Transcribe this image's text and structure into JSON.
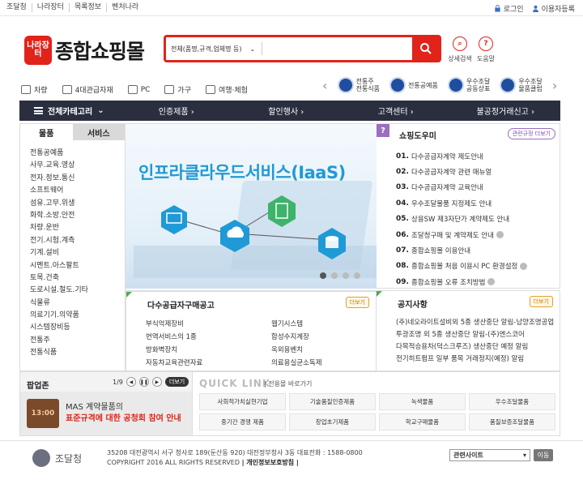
{
  "topbar": {
    "links": [
      "조달청",
      "나라장터",
      "목록정보",
      "벤처나라"
    ],
    "login": "로그인",
    "register": "이용자등록"
  },
  "header": {
    "logo_badge": "나라장터",
    "logo_text": "종합쇼핑몰",
    "search_category": "전체(품명,규격,업체명 등)",
    "search_value": "",
    "detail_search": "상세검색",
    "help": "도움말"
  },
  "quick_categories": [
    "차량",
    "4대관급자재",
    "PC",
    "가구",
    "여행·체험"
  ],
  "certs": [
    {
      "line1": "전통주",
      "line2": "전통식품"
    },
    {
      "line1": "전통공예품",
      "line2": ""
    },
    {
      "line1": "우수조달",
      "line2": "공동상표"
    },
    {
      "line1": "우수조달",
      "line2": "물품클럽"
    }
  ],
  "nav": {
    "all": "전체카테고리",
    "items": [
      "인증제품 ›",
      "할인행사 ›",
      "고객센터 ›",
      "불공정거래신고 ›"
    ]
  },
  "left_panel": {
    "tab_goods": "물품",
    "tab_service": "서비스",
    "items": [
      "전통공예품",
      "사무.교육.영상",
      "전자.정보.통신",
      "소프트웨어",
      "섬유.고무.위생",
      "화학.소방.안전",
      "차량.운반",
      "전기.시험.계측",
      "기계.설비",
      "시멘트.아스팔트",
      "토목.건축",
      "도로시설.철도.기타",
      "식물류",
      "의료기기.의약품",
      "시스템장비등",
      "전통주",
      "전통식품"
    ]
  },
  "banner": {
    "title": "인프라클라우드서비스(IaaS)"
  },
  "shopping_help": {
    "title": "쇼핑도우미",
    "more": "관련규정 더보기",
    "items": [
      {
        "num": "01.",
        "text": "다수공급자계약 제도안내"
      },
      {
        "num": "02.",
        "text": "다수공급자계약 관련 매뉴얼"
      },
      {
        "num": "03.",
        "text": "다수공급자계약 교육안내"
      },
      {
        "num": "04.",
        "text": "우수조달물품 지정제도 안내"
      },
      {
        "num": "05.",
        "text": "상용SW 제3자단가 계약제도 안내"
      },
      {
        "num": "06.",
        "text": "조달청구매 및 계약제도 안내"
      },
      {
        "num": "07.",
        "text": "종합쇼핑몰 이용안내"
      },
      {
        "num": "08.",
        "text": "종합쇼핑몰 처음 이용시 PC 환경설정"
      },
      {
        "num": "09.",
        "text": "종합쇼핑몰 오류 조치방법"
      }
    ]
  },
  "multi_supplier": {
    "title": "다수공급자구매공고",
    "more": "더보기",
    "items": [
      "부식억제장비",
      "웹기시스템",
      "번역서비스의 1종",
      "합성수지계장",
      "방화벽장치",
      "옥외용벤치",
      "자동차교육관련자료",
      "의료용실균소독제"
    ]
  },
  "notice": {
    "title": "공지사항",
    "more": "더보기",
    "items": [
      "(주)네오라이트설비외 5종 생산중단 알림-남양조명공업",
      "투광조명 외 5종 생산중단 알림-(주)엔스코어",
      "다목적승용차(덕스크루즈) 생산중단 예정 알림",
      "전기히트펌프 일부 품목 거래정지(예정) 알림"
    ]
  },
  "popup_zone": {
    "title": "팝업존",
    "page": "1/9",
    "more": "더보기",
    "clock": "13:00",
    "line1": "MAS 계약물품의",
    "line2": "표준규격에 대한 공청회 참여 안내"
  },
  "quick_link": {
    "title": "QUICK LINK",
    "subtitle": "| 전용몰 바로가기",
    "items": [
      "사회적가치실현기업",
      "기술품질인증제품",
      "녹색물품",
      "우수조달물품",
      "중기간 경쟁 제품",
      "창업초기제품",
      "학교구매물품",
      "품질보증조달물품"
    ]
  },
  "footer": {
    "org": "조달청",
    "address": "35208 대전광역시 서구 청사로 189(둔산동 920) 대전정부청사 3동 대표전화 : 1588-0800",
    "copyright": "COPYRIGHT 2016 ALL RIGHTS RESERVED",
    "privacy": "| 개인정보보호방침 |",
    "related": "관련사이트",
    "go": "이동"
  },
  "colors": {
    "brand_red": "#e2231a",
    "nav_dark": "#2a2e3f",
    "banner_blue": "#1f9ad6",
    "help_purple": "#9a6fc0"
  }
}
